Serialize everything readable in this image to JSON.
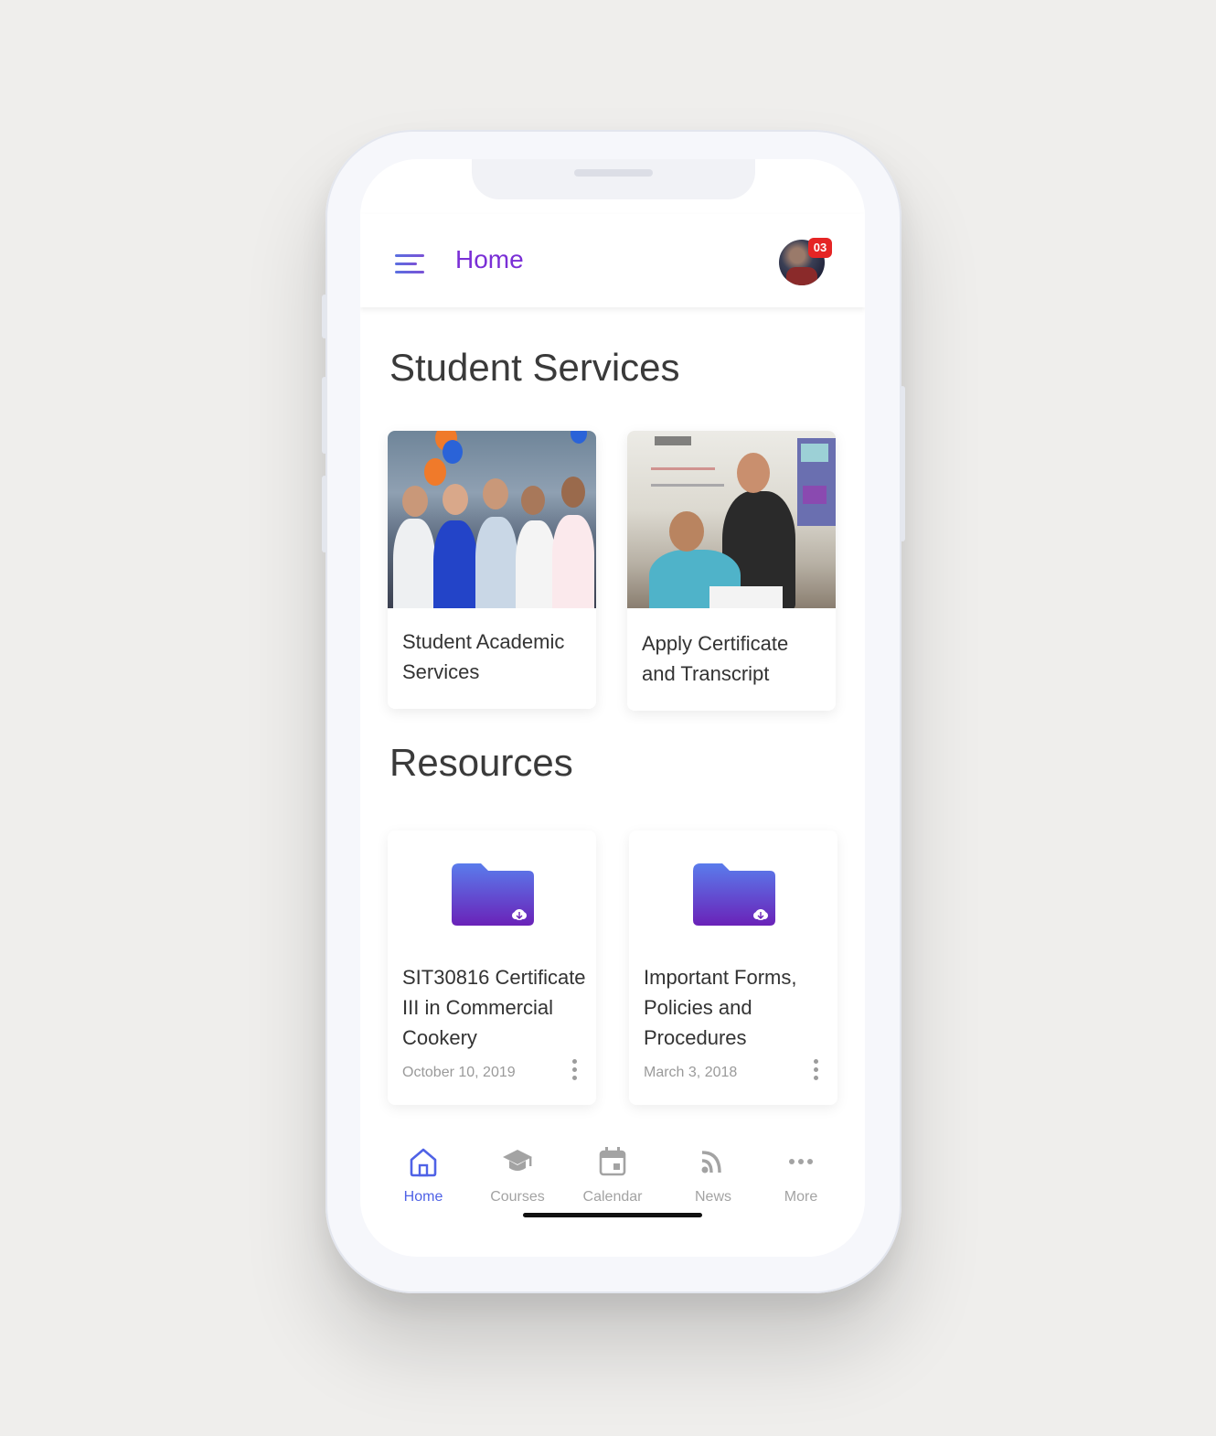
{
  "header": {
    "title": "Home",
    "notification_count": "03"
  },
  "student_services": {
    "title": "Student Services",
    "cards": [
      {
        "label": "Student Academic Services"
      },
      {
        "label": "Apply Certificate and Transcript"
      }
    ]
  },
  "resources": {
    "title": "Resources",
    "items": [
      {
        "title": "SIT30816 Certificate III in Commercial Cookery",
        "date": "October 10, 2019"
      },
      {
        "title": "Important Forms, Policies and Procedures",
        "date": "March 3, 2018"
      }
    ]
  },
  "tabbar": {
    "tabs": [
      {
        "label": "Home",
        "icon": "home-icon",
        "active": true
      },
      {
        "label": "Courses",
        "icon": "graduation-cap-icon",
        "active": false
      },
      {
        "label": "Calendar",
        "icon": "calendar-icon",
        "active": false
      },
      {
        "label": "News",
        "icon": "rss-icon",
        "active": false
      },
      {
        "label": "More",
        "icon": "more-dots-icon",
        "active": false
      }
    ]
  },
  "colors": {
    "accent_title": "#7a2fd6",
    "active_tab": "#4f62e6",
    "badge": "#e52525",
    "folder_gradient_top": "#5a7cec",
    "folder_gradient_bottom": "#6a22b8"
  }
}
